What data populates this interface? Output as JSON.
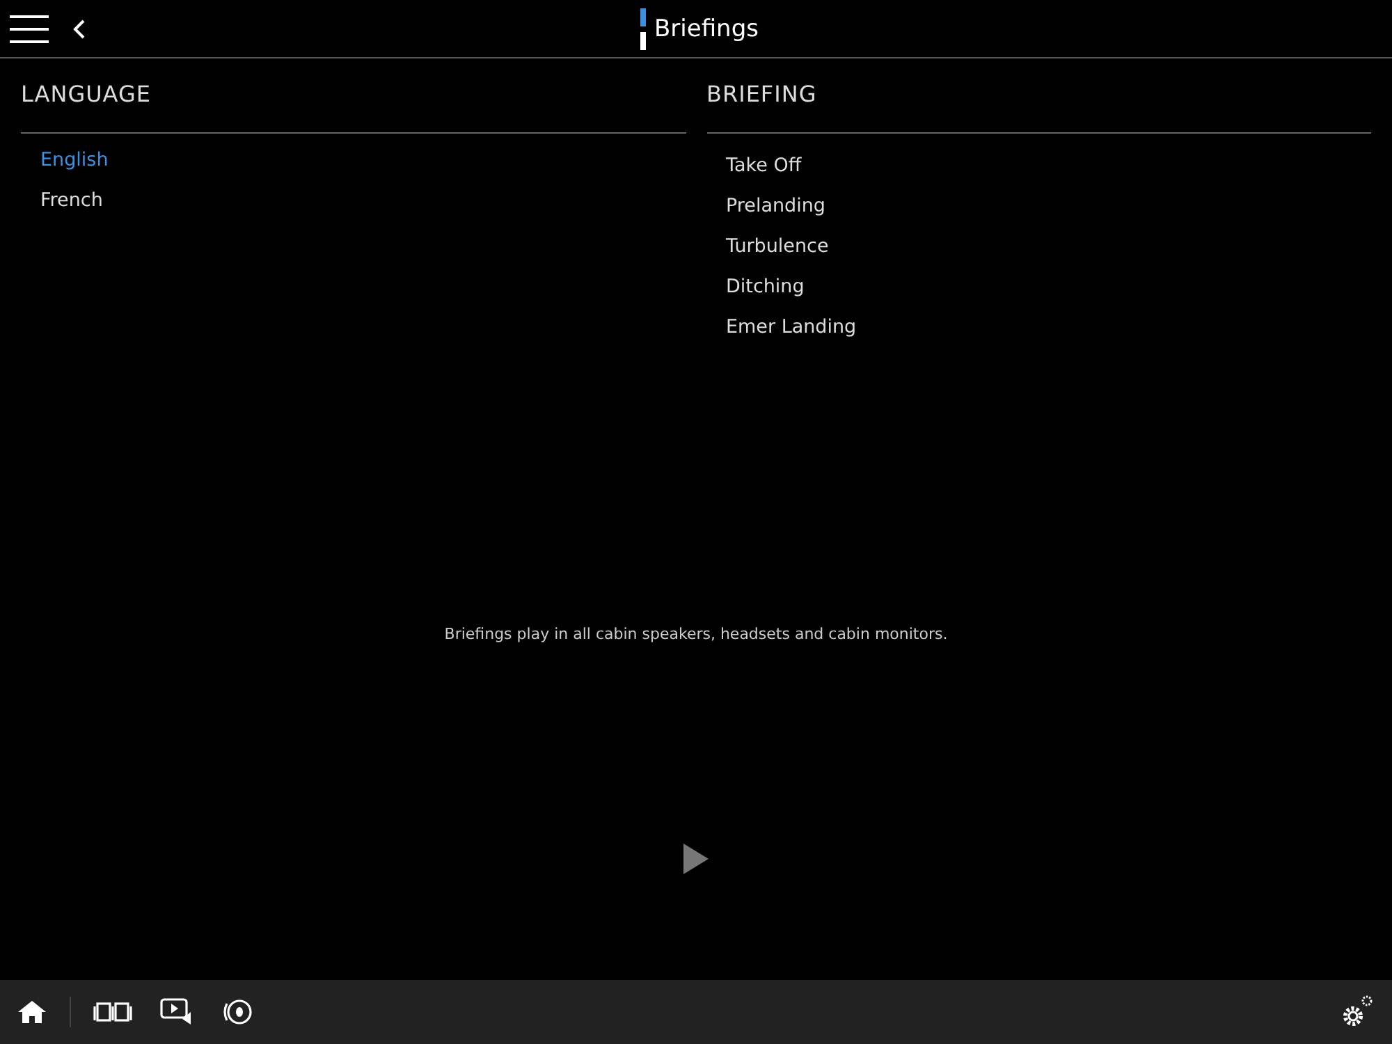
{
  "header": {
    "title": "Briefings"
  },
  "language": {
    "heading": "LANGUAGE",
    "items": [
      {
        "label": "English",
        "selected": true
      },
      {
        "label": "French",
        "selected": false
      }
    ]
  },
  "briefing": {
    "heading": "BRIEFING",
    "items": [
      {
        "label": "Take Off",
        "selected": false
      },
      {
        "label": "Prelanding",
        "selected": false
      },
      {
        "label": "Turbulence",
        "selected": false
      },
      {
        "label": "Ditching",
        "selected": false
      },
      {
        "label": "Emer Landing",
        "selected": false
      }
    ]
  },
  "note": "Briefings play in all cabin speakers, headsets and cabin monitors.",
  "play": {
    "disabled": true
  }
}
